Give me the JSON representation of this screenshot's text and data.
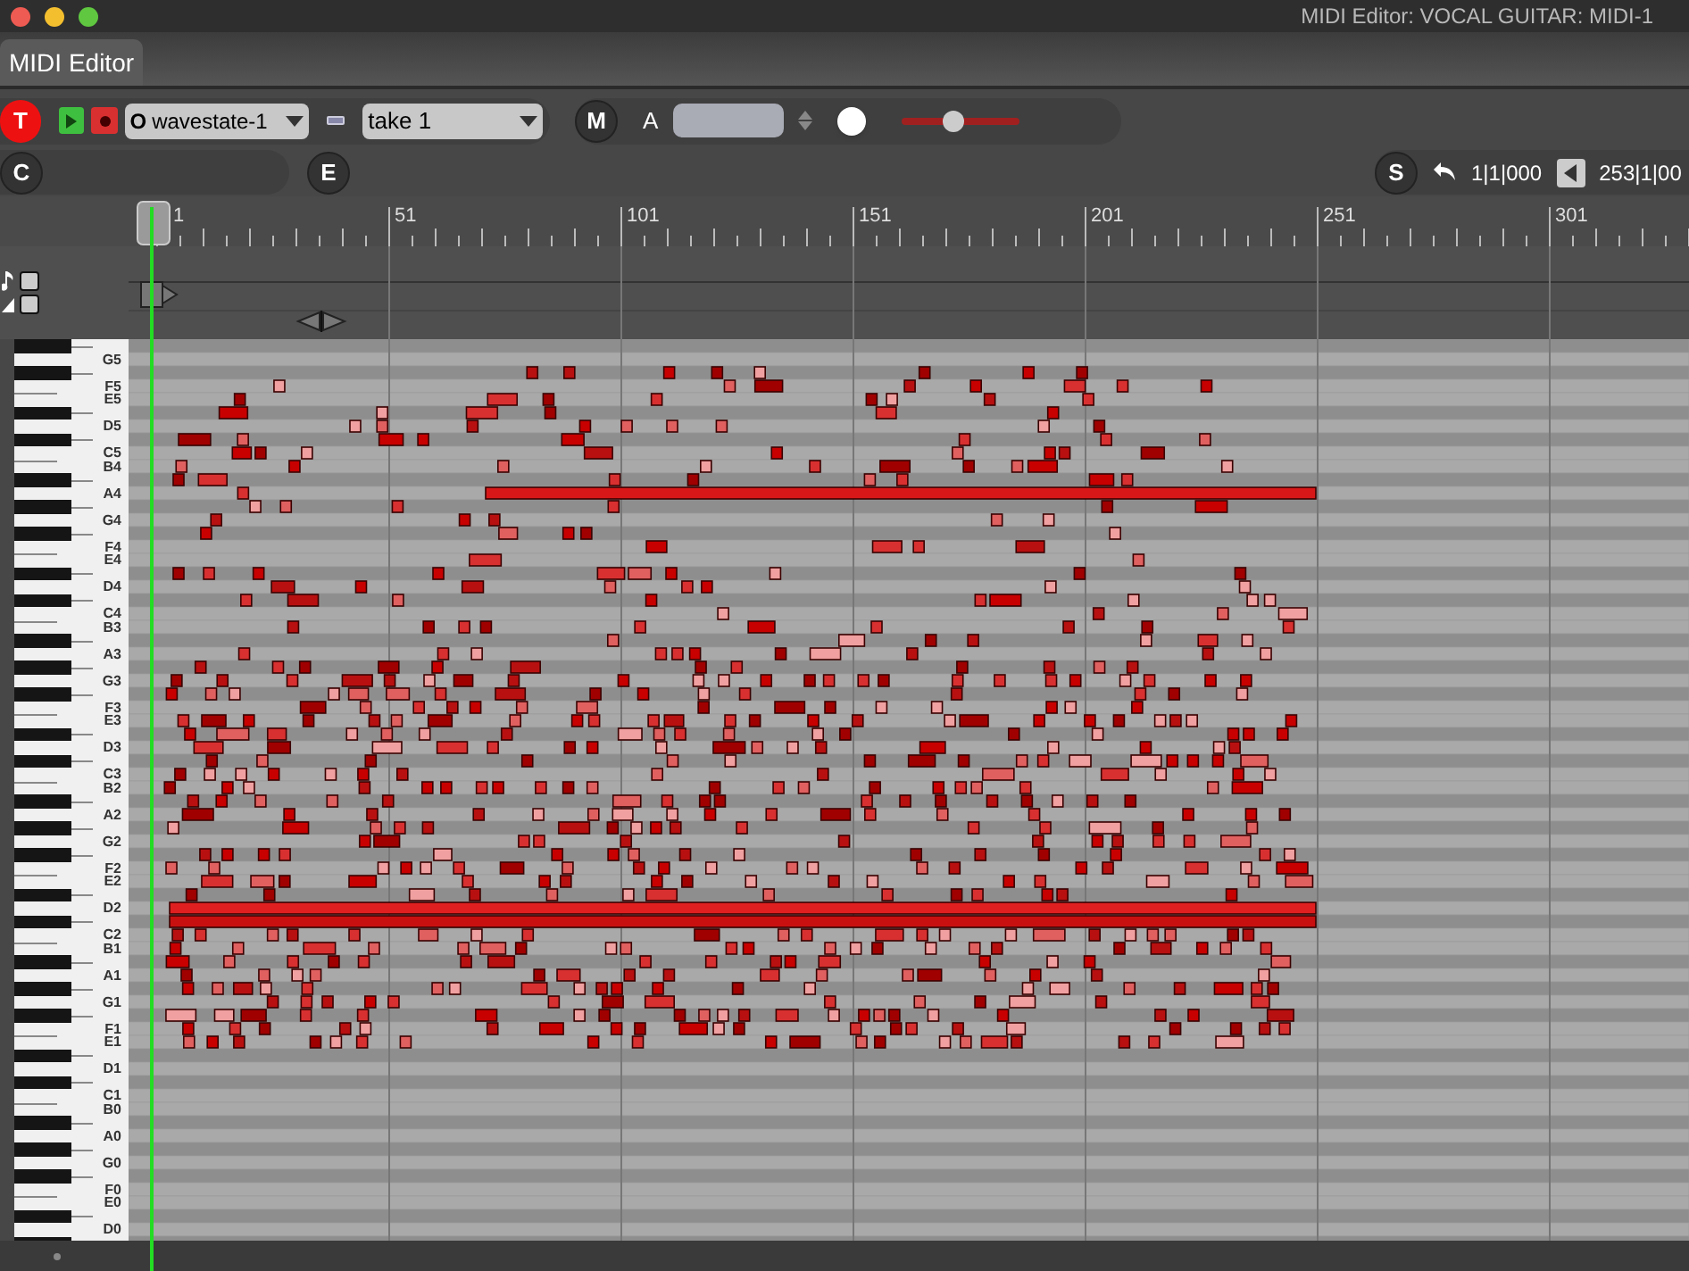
{
  "window": {
    "title": "MIDI Editor: VOCAL GUITAR: MIDI-1"
  },
  "tabs": [
    {
      "label": "MIDI Editor",
      "selected": true
    }
  ],
  "toolbar": {
    "track_button": "T",
    "instrument_prefix": "O",
    "instrument": "wavestate-1",
    "take": "take 1",
    "m_button": "M",
    "a_label": "A",
    "volume": {
      "level": 0.45
    },
    "c_button": "C",
    "e_button": "E",
    "s_button": "S",
    "start_position": "1|1|000",
    "end_position": "253|1|00"
  },
  "ruler": {
    "markers": [
      "1",
      "51",
      "101",
      "151",
      "201",
      "251",
      "301"
    ]
  },
  "keyboard": {
    "keys": [
      "G5",
      "F5",
      "E5",
      "D5",
      "C5",
      "B4",
      "A4",
      "G4",
      "F4",
      "E4",
      "D4",
      "C4",
      "B3",
      "A3",
      "G3",
      "F3",
      "E3",
      "D3",
      "C3",
      "B2",
      "A2",
      "G2",
      "F2",
      "E2",
      "D2",
      "C2",
      "B1",
      "A1",
      "G1",
      "F1",
      "E1",
      "D1",
      "C1",
      "B0",
      "A0",
      "G0",
      "F0",
      "E0",
      "D0"
    ]
  }
}
